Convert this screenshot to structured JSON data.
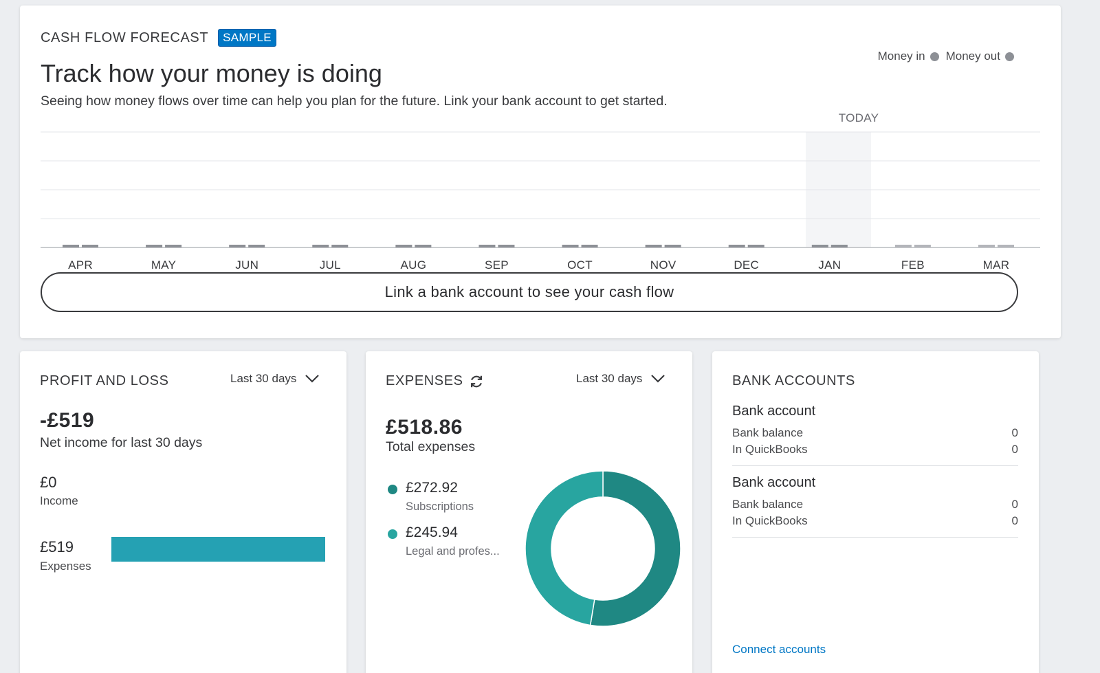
{
  "cash_flow": {
    "section_title": "CASH FLOW FORECAST",
    "badge": "SAMPLE",
    "title": "Track how your money is doing",
    "description": "Seeing how money flows over time can help you plan for the future. Link your bank account to get started.",
    "legend": {
      "money_in": "Money in",
      "money_out": "Money out",
      "color": "#8d9096"
    },
    "today_label": "TODAY",
    "link_button": "Link a bank account to see your cash flow",
    "chart_data": {
      "type": "bar",
      "categories": [
        "APR",
        "MAY",
        "JUN",
        "JUL",
        "AUG",
        "SEP",
        "OCT",
        "NOV",
        "DEC",
        "JAN",
        "FEB",
        "MAR"
      ],
      "series": [
        {
          "name": "Money in",
          "values": [
            0,
            0,
            0,
            0,
            0,
            0,
            0,
            0,
            0,
            0,
            0,
            0
          ]
        },
        {
          "name": "Money out",
          "values": [
            0,
            0,
            0,
            0,
            0,
            0,
            0,
            0,
            0,
            0,
            0,
            0
          ]
        }
      ],
      "highlighted_category": "JAN",
      "grid": true
    }
  },
  "profit_loss": {
    "title": "PROFIT AND LOSS",
    "period": "Last 30 days",
    "net_amount": "-£519",
    "net_label": "Net income for last 30 days",
    "income_amount": "£0",
    "income_label": "Income",
    "expenses_amount": "£519",
    "expenses_label": "Expenses",
    "expenses_bar_color": "#25a1b3",
    "expenses_fraction": 1.0
  },
  "expenses": {
    "title": "EXPENSES",
    "period": "Last 30 days",
    "total_amount": "£518.86",
    "total_label": "Total expenses",
    "items": [
      {
        "amount": "£272.92",
        "label": "Subscriptions",
        "color": "#1f8883"
      },
      {
        "amount": "£245.94",
        "label": "Legal and profes...",
        "color": "#28a5a0"
      }
    ],
    "chart_data": {
      "type": "pie",
      "categories": [
        "Subscriptions",
        "Legal and profes..."
      ],
      "values": [
        272.92,
        245.94
      ]
    }
  },
  "bank_accounts": {
    "title": "BANK ACCOUNTS",
    "accounts": [
      {
        "name": "Bank account",
        "bank_balance_label": "Bank balance",
        "bank_balance": "0",
        "quickbooks_label": "In QuickBooks",
        "quickbooks": "0"
      },
      {
        "name": "Bank account",
        "bank_balance_label": "Bank balance",
        "bank_balance": "0",
        "quickbooks_label": "In QuickBooks",
        "quickbooks": "0"
      }
    ],
    "connect_link": "Connect accounts"
  }
}
